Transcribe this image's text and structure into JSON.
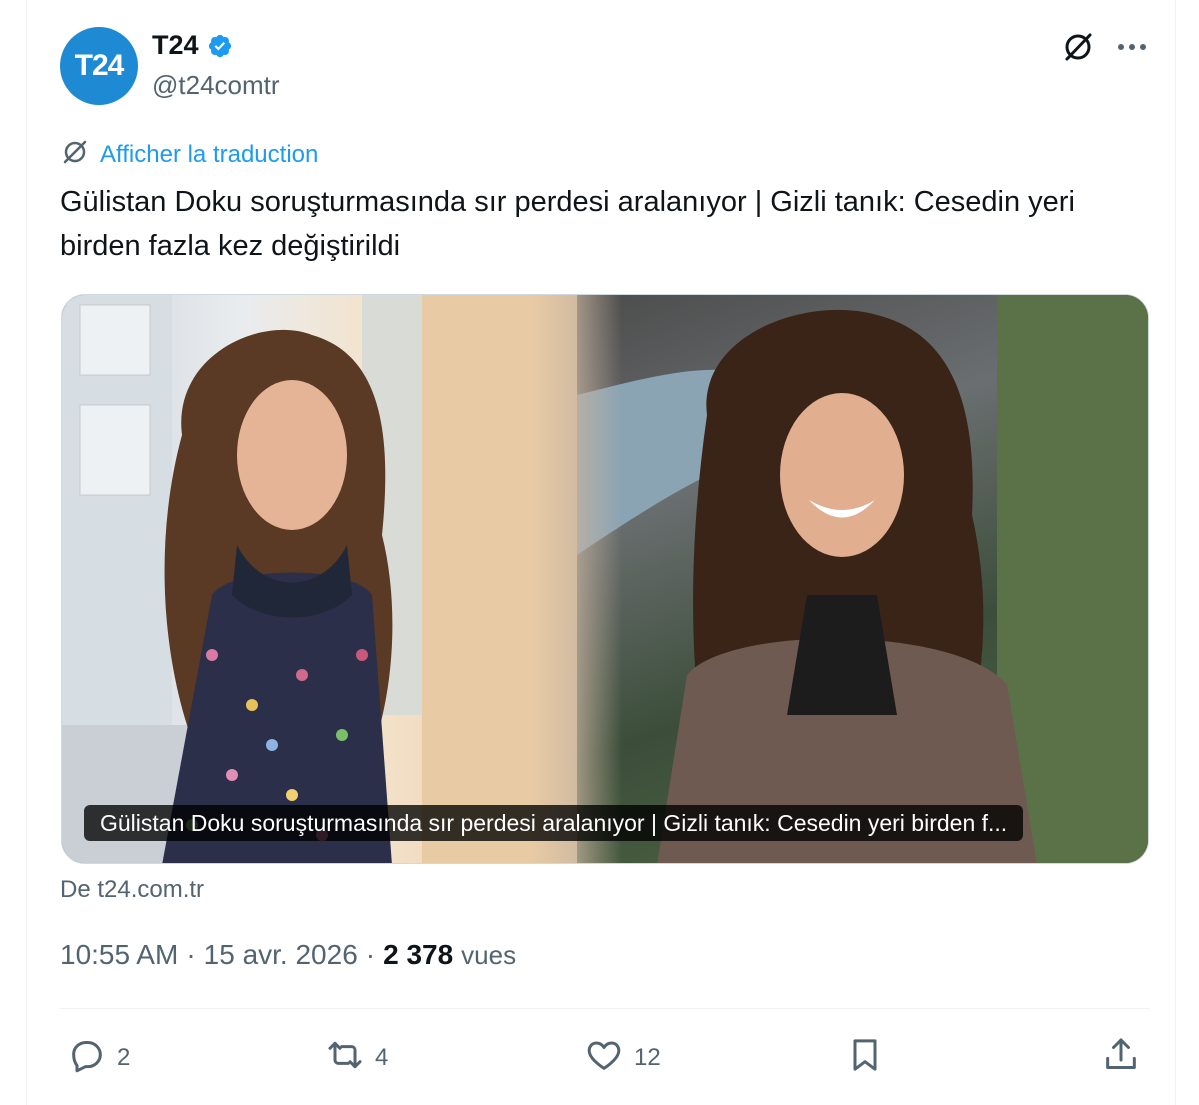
{
  "account": {
    "avatar_text": "T24",
    "name": "T24",
    "handle": "@t24comtr",
    "verified": true
  },
  "header_icons": [
    "grok-icon",
    "more-icon"
  ],
  "translate_label": "Afficher la traduction",
  "tweet_text": "Gülistan Doku soruşturmasında sır perdesi aralanıyor | Gizli tanık: Cesedin yeri birden fazla kez değiştirildi",
  "media": {
    "caption": "Gülistan Doku soruşturmasında sır perdesi aralanıyor | Gizli tanık: Cesedin yeri birden f..."
  },
  "source": "De t24.com.tr",
  "meta": {
    "time": "10:55 AM",
    "date": "15 avr. 2026",
    "views_count": "2 378",
    "views_label": "vues",
    "separator": "·"
  },
  "actions": {
    "replies": "2",
    "reposts": "4",
    "likes": "12"
  },
  "colors": {
    "accent": "#1d9bf0",
    "secondary_text": "#536471",
    "avatar_bg": "#1e8ad3"
  }
}
